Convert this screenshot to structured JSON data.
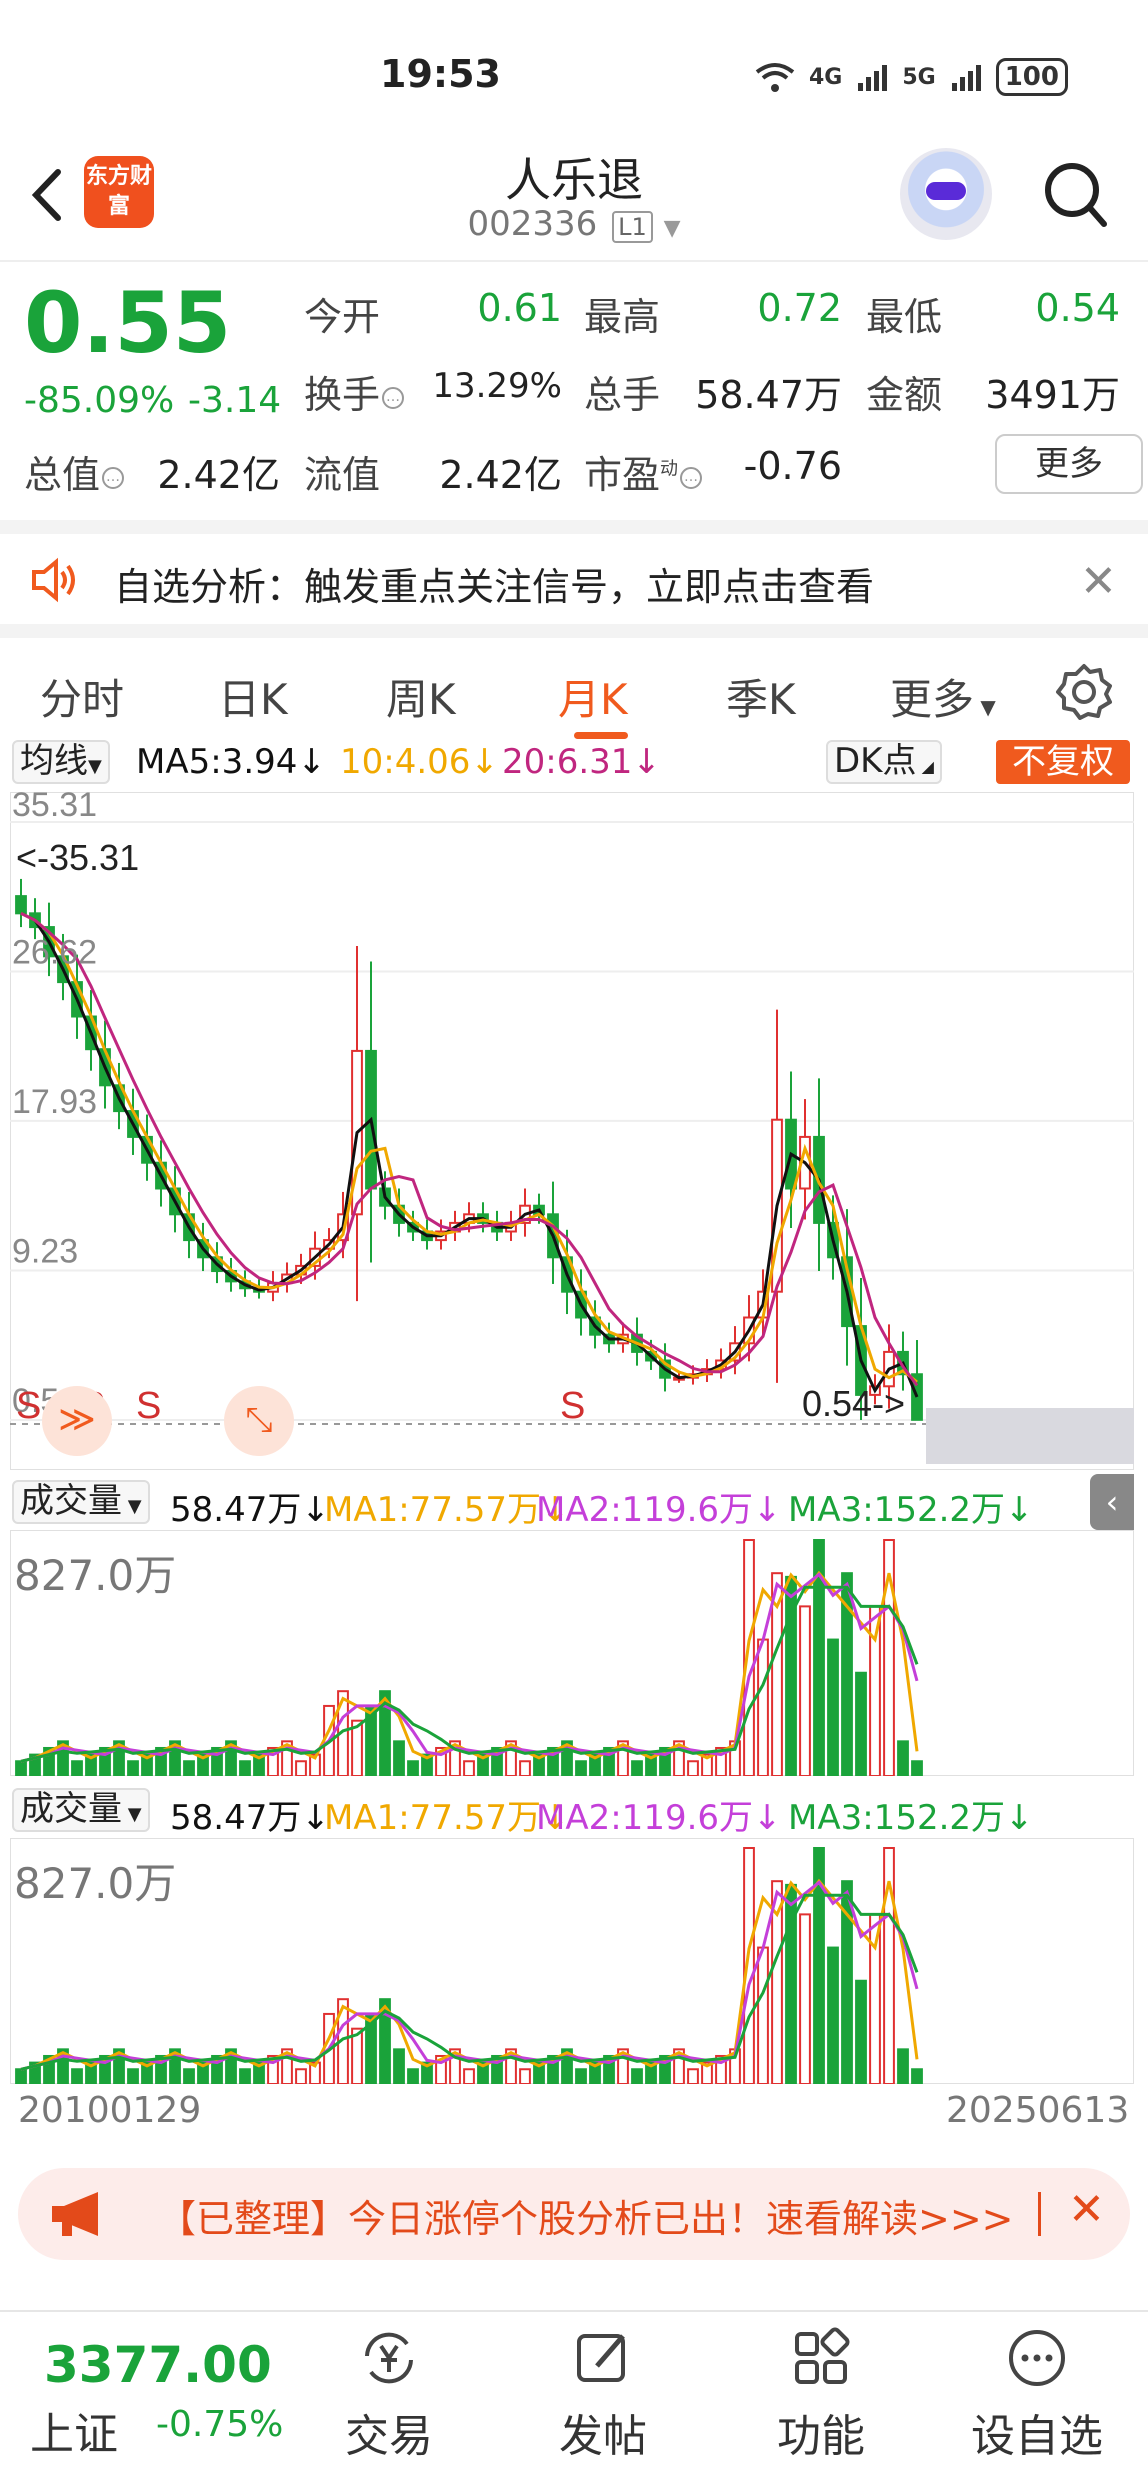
{
  "status_bar": {
    "time": "19:53",
    "network_1": "4G",
    "network_2": "5G",
    "battery": "100"
  },
  "header": {
    "name": "人乐退",
    "code": "002336",
    "level": "L1",
    "logo_text": "东方财富"
  },
  "quote": {
    "price": "0.55",
    "pct": "-85.09%",
    "change": "-3.14",
    "open_label": "今开",
    "open": "0.61",
    "high_label": "最高",
    "high": "0.72",
    "low_label": "最低",
    "low": "0.54",
    "turnover_label": "换手",
    "turnover": "13.29%",
    "volume_label": "总手",
    "volume": "58.47万",
    "amount_label": "金额",
    "amount": "3491万",
    "mktcap_label": "总值",
    "mktcap": "2.42亿",
    "float_label": "流值",
    "float": "2.42亿",
    "pe_label": "市盈",
    "pe_sup": "动",
    "pe": "-0.76",
    "more": "更多"
  },
  "alert": {
    "text": "自选分析：触发重点关注信号，立即点击查看"
  },
  "tabs": [
    "分时",
    "日K",
    "周K",
    "月K",
    "季K",
    "更多"
  ],
  "active_tab": "月K",
  "ma_row": {
    "selector": "均线",
    "ma5": "MA5:3.94↓",
    "ma10": "10:4.06↓",
    "ma20": "20:6.31↓",
    "dk": "DK点",
    "fq": "不复权",
    "colors": {
      "ma5": "#111111",
      "ma10": "#f0a800",
      "ma20": "#c0267f"
    }
  },
  "kchart": {
    "y_labels": [
      "35.31",
      "26.62",
      "17.93",
      "9.23",
      "0.54"
    ],
    "high_marker": "<-35.31",
    "low_marker": "0.54->",
    "signals": [
      "S",
      "S",
      "S",
      "S"
    ]
  },
  "volume_panels": [
    {
      "selector": "成交量",
      "vol": "58.47万↓",
      "ma1": "MA1:77.57万↓",
      "ma2": "MA2:119.6万↓",
      "ma3": "MA3:152.2万↓",
      "max": "827.0万"
    },
    {
      "selector": "成交量",
      "vol": "58.47万↓",
      "ma1": "MA1:77.57万↓",
      "ma2": "MA2:119.6万↓",
      "ma3": "MA3:152.2万↓",
      "max": "827.0万"
    }
  ],
  "x_axis": {
    "start": "20100129",
    "end": "20250613"
  },
  "ad": {
    "text": "【已整理】今日涨停个股分析已出！速看解读>>>"
  },
  "bottom": {
    "index_value": "3377.00",
    "index_name": "上证",
    "index_pct": "-0.75%",
    "nav": [
      "交易",
      "发帖",
      "功能",
      "设自选"
    ]
  },
  "chart_data": {
    "type": "candlestick",
    "title": "",
    "ylim": [
      0.54,
      35.31
    ],
    "x_range": [
      "20100129",
      "20250613"
    ],
    "close_approx": [
      30.0,
      29.2,
      27.5,
      26.0,
      24.0,
      22.1,
      20.0,
      18.5,
      17.0,
      15.5,
      14.0,
      12.5,
      11.0,
      10.0,
      9.2,
      8.6,
      8.2,
      8.0,
      8.5,
      9.0,
      9.5,
      10.5,
      11.0,
      12.5,
      22.0,
      14.0,
      13.0,
      12.0,
      11.5,
      11.0,
      11.5,
      12.0,
      12.5,
      12.0,
      11.5,
      12.0,
      13.0,
      12.5,
      10.0,
      8.0,
      6.5,
      5.5,
      5.0,
      5.5,
      4.5,
      4.0,
      3.0,
      3.0,
      3.2,
      3.5,
      4.0,
      5.0,
      6.5,
      8.0,
      18.0,
      14.0,
      17.0,
      12.0,
      10.0,
      6.0,
      2.0,
      2.5,
      4.5,
      3.2,
      0.55
    ]
  }
}
